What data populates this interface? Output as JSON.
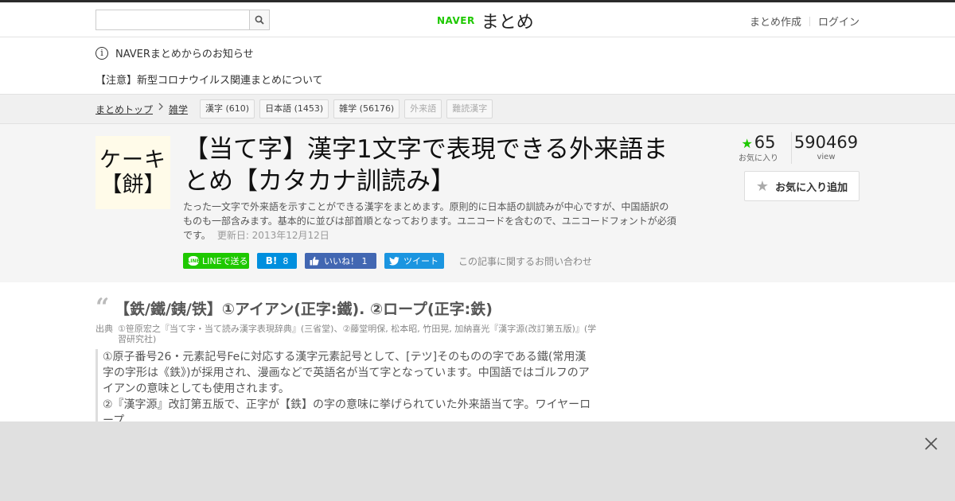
{
  "header": {
    "search_placeholder": "",
    "logo_brand": "NAVER",
    "logo_title": "まとめ",
    "create_link": "まとめ作成",
    "login_link": "ログイン"
  },
  "notices": {
    "info": "NAVERまとめからのお知らせ",
    "covid": "【注意】新型コロナウイルス関連まとめについて"
  },
  "breadcrumb": {
    "home": "まとめトップ",
    "category": "雑学",
    "tags": [
      {
        "label": "漢字 (610)",
        "dim": false
      },
      {
        "label": "日本語 (1453)",
        "dim": false
      },
      {
        "label": "雑学 (56176)",
        "dim": false
      },
      {
        "label": "外来語",
        "dim": true
      },
      {
        "label": "難読漢字",
        "dim": true
      }
    ]
  },
  "article": {
    "thumb_line1": "ケーキ",
    "thumb_line2": "【餅】",
    "title": "【当て字】漢字1文字で表現できる外来語まとめ【カタカナ訓読み】",
    "description": "たった一文字で外来語を示すことができる漢字をまとめます。原則的に日本語の訓読みが中心ですが、中国語訳のものも一部含みます。基本的に並びは部首順となっております。ユニコードを含むので、ユニコードフォントが必須です。",
    "updated": "更新日: 2013年12月12日",
    "favorites_count": "65",
    "favorites_label": "お気に入り",
    "views_count": "590469",
    "views_label": "view",
    "fav_button": "お気に入り追加"
  },
  "social": {
    "line": "LINEで送る",
    "line_icon": "LINE",
    "hatena_icon": "B!",
    "hatena_count": "8",
    "fb": "いいね！ 1",
    "tweet": "ツイート",
    "inquiry": "この記事に関するお問い合わせ"
  },
  "item": {
    "heading": "【鉄/鐵/銕/铁】①アイアン(正字:鐵). ②ロープ(正字:鉄)",
    "source_label": "出典",
    "source_text": "①笹原宏之『当て字・当て読み漢字表現辞典』(三省堂)、②藤堂明保, 松本昭, 竹田晃, 加納喜光『漢字源(改訂第五版)』(学習研究社)",
    "body_1": "①原子番号26・元素記号Feに対応する漢字元素記号として、[テツ]そのものの字である鐵(常用漢字の字形は《鉄》)が採用され、漫画などで英語名が当て字となっています。中国語ではゴルフのアイアンの意味としても使用されます。",
    "body_2": "②『漢字源』改訂第五版で、正字が【鉄】の字の意味に挙げられていた外来語当て字。ワイヤーロープ"
  },
  "colors": {
    "naver_green": "#1ec800",
    "hatena_blue": "#008fde",
    "fb_blue": "#4267b2",
    "twitter_blue": "#1b95e0"
  }
}
